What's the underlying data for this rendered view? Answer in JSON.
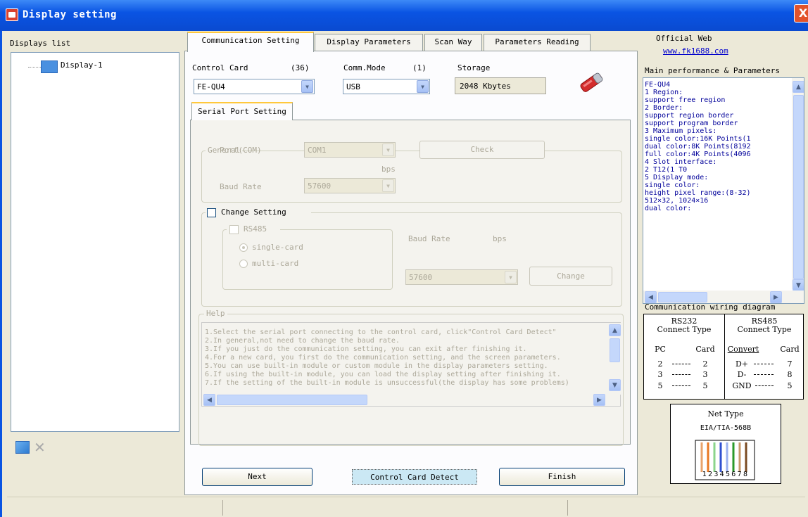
{
  "window": {
    "title": "Display setting",
    "close_glyph": "X"
  },
  "left": {
    "displays_label": "Displays list",
    "tree_items": [
      {
        "label": "Display-1",
        "icon": "monitor-icon"
      }
    ],
    "bottom_icons": [
      "add-display-icon",
      "delete-icon"
    ],
    "delete_glyph": "✕"
  },
  "tabs": [
    {
      "label": "Communication Setting",
      "active": true
    },
    {
      "label": "Display Parameters",
      "active": false
    },
    {
      "label": "Scan Way",
      "active": false
    },
    {
      "label": "Parameters Reading",
      "active": false
    }
  ],
  "comm": {
    "control_card_label": "Control Card",
    "control_card_count": "(36)",
    "control_card_value": "FE-QU4",
    "comm_mode_label": "Comm.Mode",
    "comm_mode_count": "(1)",
    "comm_mode_value": "USB",
    "storage_label": "Storage",
    "storage_value": "2048 Kbytes",
    "serial_tab": "Serial Port Setting",
    "general_legend": "General",
    "port_label": "Port(COM)",
    "port_value": "COM1",
    "check_btn": "Check",
    "bps_label": "bps",
    "baud_label": "Baud Rate",
    "baud_value": "57600",
    "change_setting_label": "Change Setting",
    "rs485_label": "RS485",
    "single_card": "single-card",
    "multi_card": "multi-card",
    "baud_label2": "Baud Rate",
    "bps_label2": "bps",
    "baud_value2": "57600",
    "change_btn": "Change",
    "help_legend": "Help",
    "help_lines": [
      "1.Select the serial port connecting to the control card, click\"Control Card Detect\"",
      "2.In general,not need to change the baud rate.",
      "3.If you just do the communication setting, you can exit after finishing it.",
      "4.For a new card, you first do the communication setting, and the screen parameters.",
      "5.You can use built-in module or custom module in the display parameters setting.",
      "6.If using the built-in module, you can load the display setting after finishing it.",
      "7.If the setting of the built-in module is unsuccessful(the display has some problems)"
    ]
  },
  "buttons": {
    "next": "Next",
    "detect": "Control Card Detect",
    "finish": "Finish"
  },
  "right": {
    "official_label": "Official Web",
    "official_url": "www.fk1688.com",
    "main_perf_label": "Main performance & Parameters",
    "perf_lines": [
      "FE-QU4",
      "1 Region:",
      "  support free region",
      "2 Border:",
      "  support region border",
      "  support program border",
      "3 Maximum pixels:",
      "  single color:16K Points(1",
      "  dual color:8K Points(8192",
      "  full color:4K Points(4096",
      "4 Slot interface:",
      "  2 T12(1 T0",
      "5 Display mode:",
      "  single color:",
      "  height pixel range:(8-32)",
      "  512×32, 1024×16",
      "  dual color:"
    ],
    "wiring_label": "Communication wiring diagram",
    "rs232_title": "RS232",
    "rs232_sub": "Connect Type",
    "rs232_head": [
      "PC",
      "Card"
    ],
    "rs232_rows": [
      [
        "2",
        "2"
      ],
      [
        "3",
        "3"
      ],
      [
        "5",
        "5"
      ]
    ],
    "rs485_title": "RS485",
    "rs485_sub": "Connect Type",
    "rs485_head": [
      "Convert",
      "Card"
    ],
    "rs485_rows": [
      [
        "D+",
        "7"
      ],
      [
        "D-",
        "8"
      ],
      [
        "GND",
        "5"
      ]
    ],
    "net_type": "Net Type",
    "net_std": "EIA/TIA-568B",
    "net_pins": "12345678"
  },
  "colors": {
    "title_bar": "#0a54e3",
    "help_text": "#aca899",
    "perf_text": "#00009a"
  }
}
